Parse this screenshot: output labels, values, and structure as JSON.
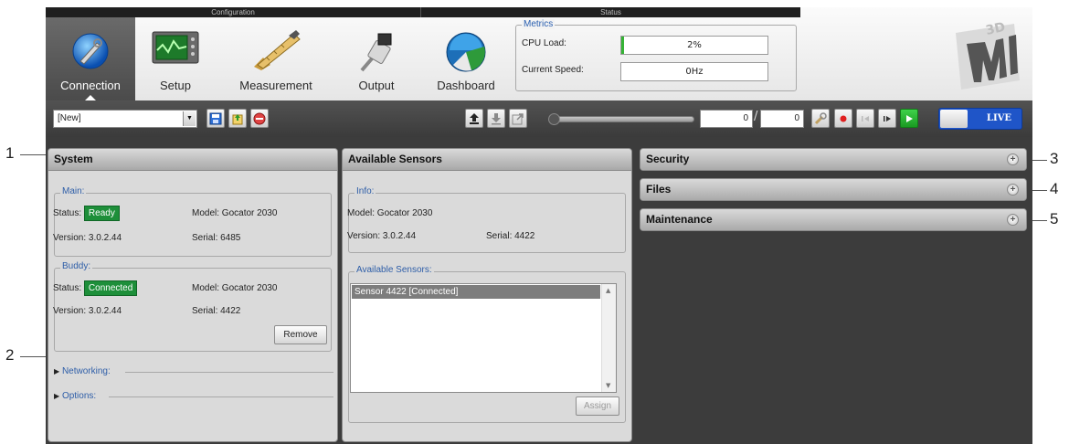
{
  "ribbon": {
    "group_configuration": "Configuration",
    "group_status": "Status",
    "buttons": {
      "connection": "Connection",
      "setup": "Setup",
      "measurement": "Measurement",
      "output": "Output",
      "dashboard": "Dashboard"
    },
    "metrics": {
      "title": "Metrics",
      "cpu_label": "CPU Load:",
      "cpu_value": "2%",
      "cpu_fraction": 0.02,
      "speed_label": "Current Speed:",
      "speed_value": "0Hz"
    }
  },
  "toolbar": {
    "job_combo": "[New]",
    "frame_current": "0",
    "frame_total": "0",
    "live_label": "LIVE",
    "icons": [
      "save-icon",
      "load-icon",
      "stop-icon",
      "upload-icon",
      "download-icon",
      "export-icon",
      "wrench-icon",
      "record-icon",
      "step-back-icon",
      "step-forward-icon",
      "play-icon"
    ]
  },
  "system": {
    "title": "System",
    "main": {
      "legend": "Main:",
      "status_label": "Status:",
      "status_value": "Ready",
      "model": "Model: Gocator 2030",
      "version": "Version: 3.0.2.44",
      "serial": "Serial: 6485"
    },
    "buddy": {
      "legend": "Buddy:",
      "status_label": "Status:",
      "status_value": "Connected",
      "model": "Model: Gocator 2030",
      "version": "Version: 3.0.2.44",
      "serial": "Serial: 4422",
      "remove_label": "Remove"
    },
    "networking": "Networking:",
    "options": "Options:"
  },
  "sensors": {
    "title": "Available Sensors",
    "info": {
      "legend": "Info:",
      "model": "Model: Gocator 2030",
      "version": "Version: 3.0.2.44",
      "serial": "Serial: 4422"
    },
    "list_legend": "Available Sensors:",
    "list_items": [
      "Sensor 4422 [Connected]"
    ],
    "assign_label": "Assign"
  },
  "right_panels": {
    "security": "Security",
    "files": "Files",
    "maintenance": "Maintenance"
  },
  "callouts": [
    "1",
    "2",
    "3",
    "4",
    "5"
  ],
  "colors": {
    "status_green": "#1e8f3a",
    "live_blue": "#1f55c8",
    "legend_blue": "#2e5ea8"
  }
}
